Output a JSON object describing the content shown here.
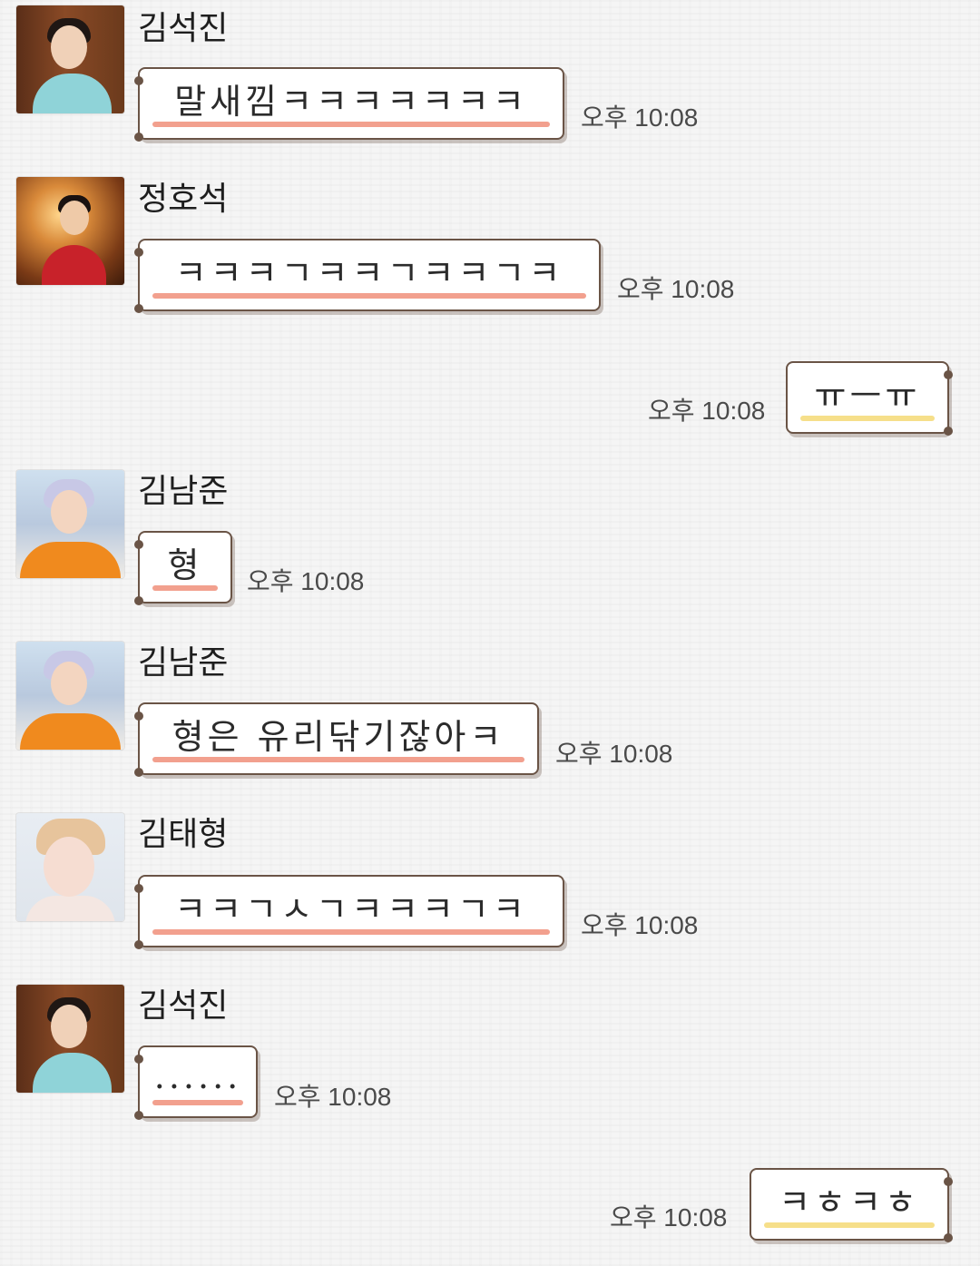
{
  "messages": [
    {
      "sender": "김석진",
      "text": "말새낌ㅋㅋㅋㅋㅋㅋㅋ",
      "time": "오후 10:08",
      "avatar_icon": "jin-avatar-icon"
    },
    {
      "sender": "정호석",
      "text": "ㅋㅋㅋㄱㅋㅋㄱㅋㅋㄱㅋ",
      "time": "오후 10:08",
      "avatar_icon": "jhope-avatar-icon"
    },
    {
      "sender": "",
      "text": "ㅠㅡㅠ",
      "time": "오후 10:08",
      "outgoing": true
    },
    {
      "sender": "김남준",
      "text": "형",
      "time": "오후 10:08",
      "avatar_icon": "rm-avatar-icon"
    },
    {
      "sender": "김남준",
      "text": "형은 유리닦기잖아ㅋ",
      "time": "오후 10:08",
      "avatar_icon": "rm-avatar-icon"
    },
    {
      "sender": "김태형",
      "text": "ㅋㅋㄱㅅㄱㅋㅋㅋㄱㅋ",
      "time": "오후 10:08",
      "avatar_icon": "v-avatar-icon"
    },
    {
      "sender": "김석진",
      "text": "......",
      "time": "오후 10:08",
      "avatar_icon": "jin-avatar-icon"
    },
    {
      "sender": "",
      "text": "ㅋㅎㅋㅎ",
      "time": "오후 10:08",
      "outgoing": true
    }
  ],
  "colors": {
    "incoming_underline": "#f2a08e",
    "outgoing_underline": "#f6df8a",
    "bubble_border": "#6a5446",
    "background": "#f5f5f5"
  }
}
